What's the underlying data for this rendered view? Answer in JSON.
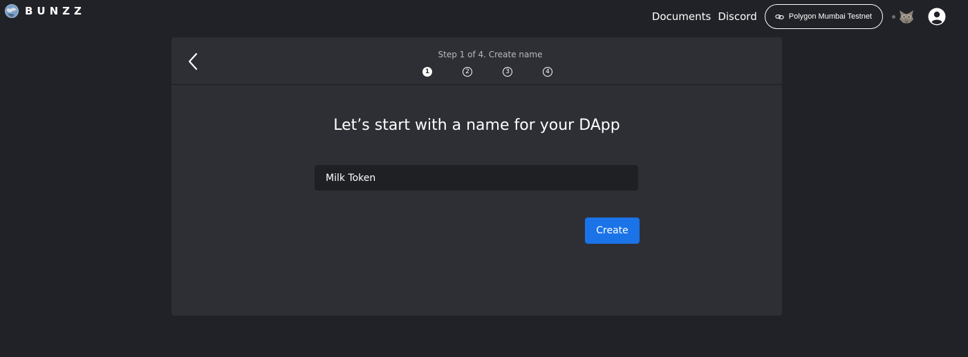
{
  "app": {
    "logo_text": "BUNZZ",
    "logo_icon": "globe-icon"
  },
  "nav": {
    "documents_label": "Documents",
    "discord_label": "Discord",
    "network_label": "Polygon Mumbai Testnet",
    "network_icon": "link-icon",
    "wallet_icon": "metamask-fox-icon",
    "account_icon": "user-circle-icon"
  },
  "wizard": {
    "step_caption": "Step 1 of 4. Create name",
    "current_step": 1,
    "steps": [
      "1",
      "2",
      "3",
      "4"
    ],
    "back_icon": "chevron-left-icon",
    "title": "Let’s start with a name for your DApp",
    "name_input_value": "Milk Token",
    "create_label": "Create"
  },
  "colors": {
    "background": "#212227",
    "card": "#2d2f35",
    "input": "#1f2024",
    "primary": "#1b73e8",
    "text": "#ffffff"
  }
}
